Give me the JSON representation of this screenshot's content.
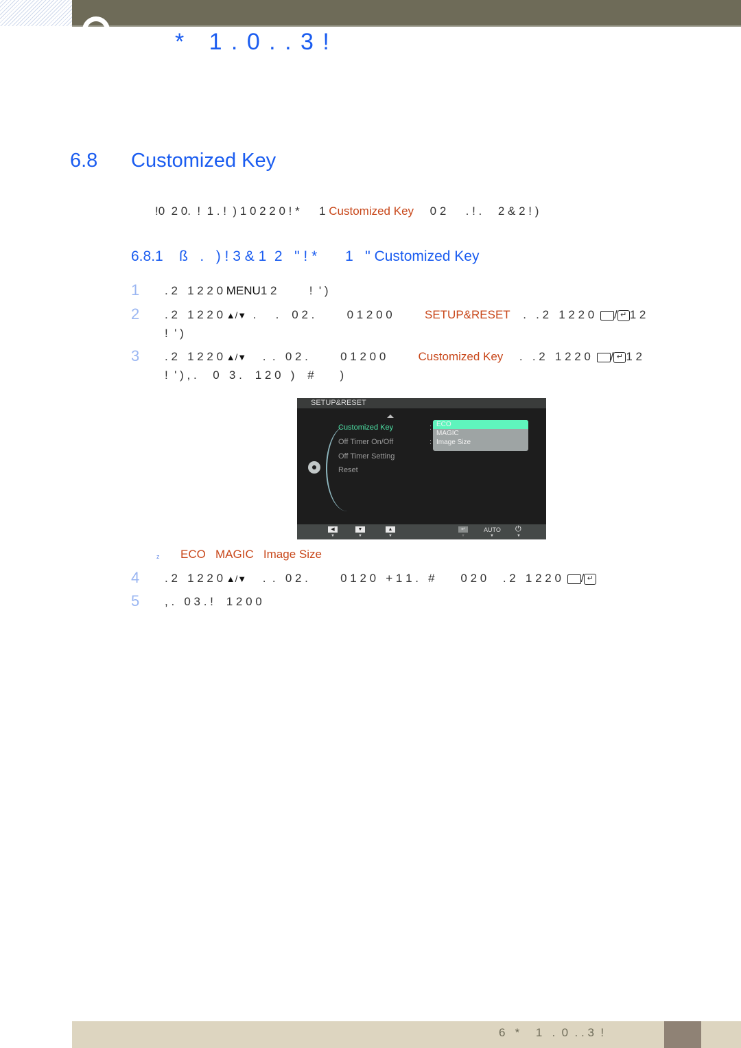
{
  "header": {
    "title": "*   1 . 0 . . 3 !"
  },
  "section": {
    "number": "6.8",
    "title": "Customized Key",
    "intro_prefix": "!0  2 0.  !  1 . !  ) 1 0 2 2 0 ! *      1 ",
    "intro_highlight": "Customized Key",
    "intro_suffix": "     0 2      . ! .     2 & 2 ! )"
  },
  "subsection": {
    "number": "6.8.1",
    "title_prefix": "ß   .   ) ! 3 & 1  2   \" ! *       1   \" ",
    "title_highlight": "Customized Key"
  },
  "steps": [
    {
      "num": "1",
      "prefix": ". 2   1 2 2 0 ",
      "key": "MENU",
      "suffix": "1 2          !  ' )"
    },
    {
      "num": "2",
      "prefix": ". 2   1 2 2 0 ",
      "arrows": "▲/▼",
      "middle": "  .      .    0 2 .          0 1 2 0 0          ",
      "highlight": "SETUP&RESET",
      "after": "    .   . 2   1 2 2 0 ",
      "end": "1 2",
      "line2": "!  ' )"
    },
    {
      "num": "3",
      "prefix": ". 2   1 2 2 0 ",
      "arrows": "▲/▼",
      "middle": "     .  .   0 2 .          0 1 2 0 0          ",
      "highlight": "Customized Key",
      "after": "     .   . 2   1 2 2 0 ",
      "end": "1 2",
      "line2": "!  ' ) , .     0   3 .    1 2 0   )    #        )"
    },
    {
      "num": "4",
      "prefix": ". 2   1 2 2 0 ",
      "arrows": "▲/▼",
      "middle": "     .  .   0 2 .          0 1 2 0   + 1 1 .   #        0 2 0     . 2   1 2 2 0 "
    },
    {
      "num": "5",
      "text": ", .   0 3 . !    1 2 0 0"
    }
  ],
  "osd": {
    "title": "SETUP&RESET",
    "items": [
      {
        "label": "Customized Key",
        "active": true,
        "colon": ":"
      },
      {
        "label": "Off Timer On/Off",
        "active": false,
        "colon": ":"
      },
      {
        "label": "Off Timer Setting",
        "active": false,
        "colon": ""
      },
      {
        "label": "Reset",
        "active": false,
        "colon": ""
      }
    ],
    "options": [
      {
        "label": "ECO",
        "selected": true
      },
      {
        "label": "MAGIC",
        "selected": false
      },
      {
        "label": "Image Size",
        "selected": false
      }
    ],
    "footer": {
      "left_label": "◀",
      "down_label": "▼",
      "up_label": "▲",
      "enter_label": "↵",
      "auto_label": "AUTO",
      "power_label": "⏻",
      "indicator": "▼"
    }
  },
  "note": {
    "marker": "z",
    "options": "ECO   MAGIC   Image Size"
  },
  "footer": {
    "text": "6   *     1   .  0  . . 3  !"
  },
  "colors": {
    "accent_blue": "#1a5cf0",
    "highlight_orange": "#c8471a",
    "osd_active_green": "#4de3a6",
    "topbar": "#6e6b58",
    "footer_bg": "#ddd5c0"
  }
}
